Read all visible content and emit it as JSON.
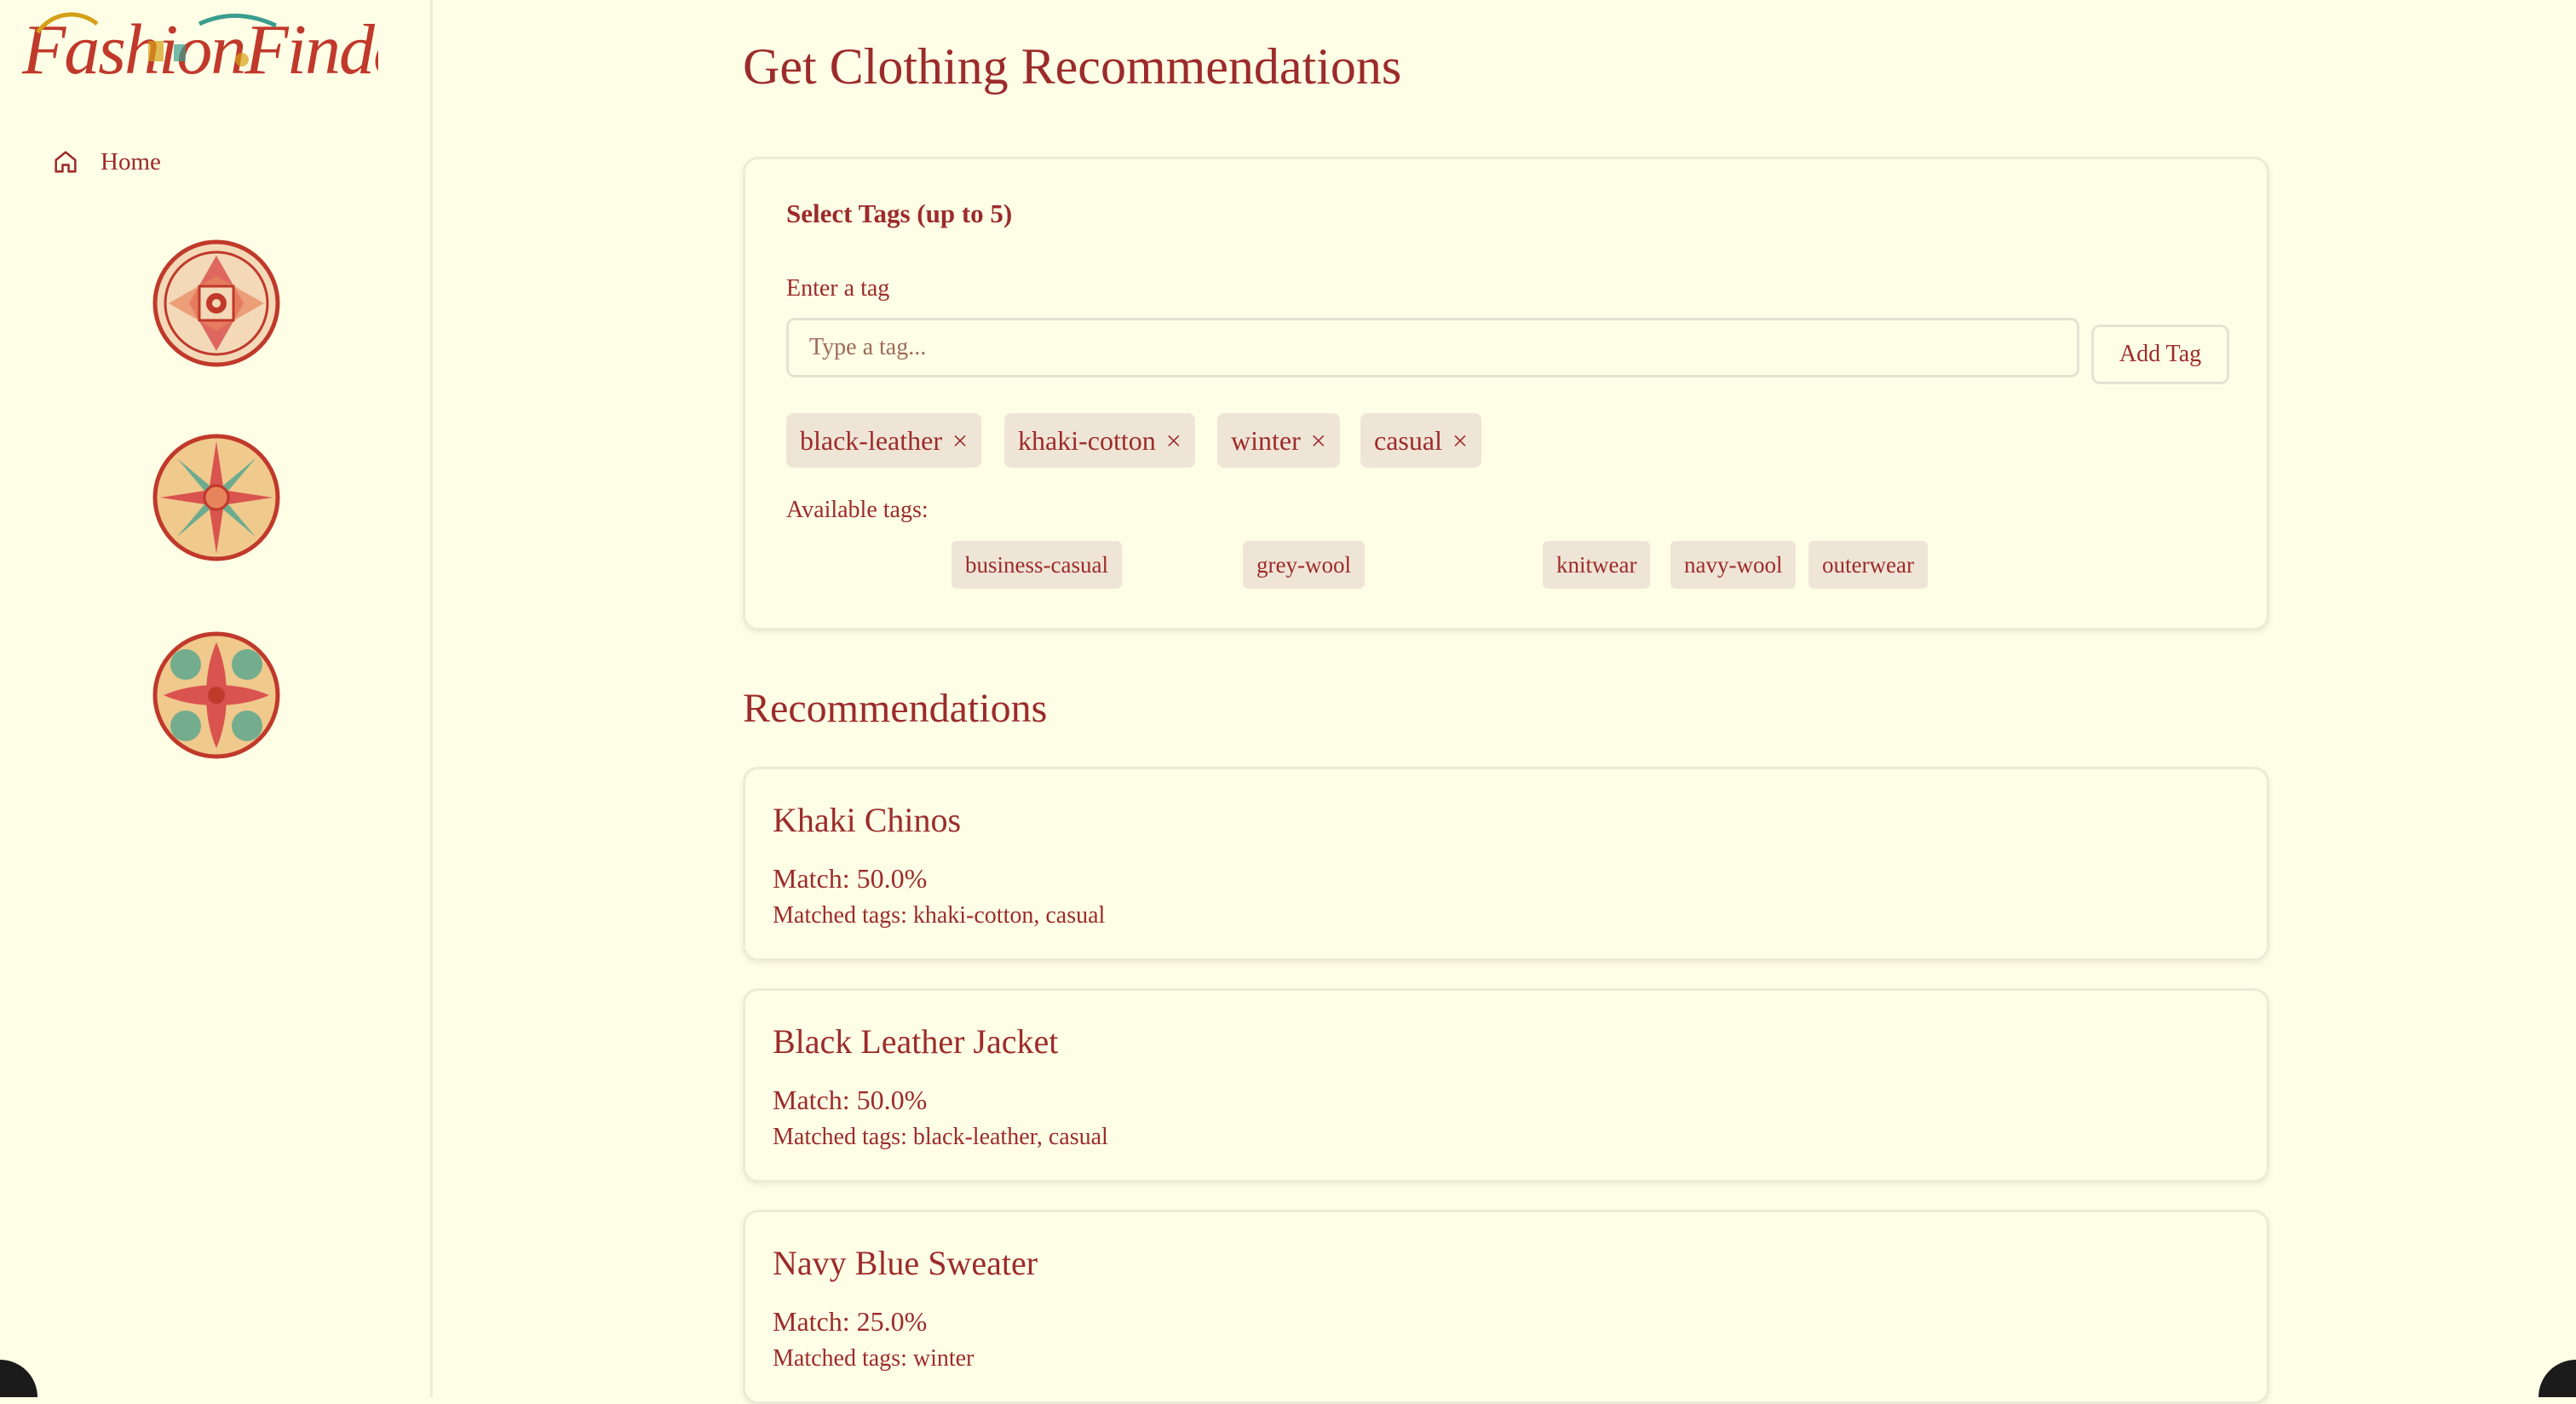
{
  "brand": {
    "logo_text": "FashionFinders"
  },
  "sidebar": {
    "home_label": "Home",
    "medallions": [
      "medallion-1",
      "medallion-2",
      "medallion-3"
    ]
  },
  "page": {
    "title": "Get Clothing Recommendations"
  },
  "tag_selector": {
    "heading": "Select Tags (up to 5)",
    "input_label": "Enter a tag",
    "input_value": "",
    "input_placeholder": "Type a tag...",
    "add_button_label": "Add Tag",
    "remove_icon": "×",
    "selected_tags": [
      "black-leather",
      "khaki-cotton",
      "winter",
      "casual"
    ],
    "available_label": "Available tags:",
    "available_tags": [
      "business-casual",
      "grey-wool",
      "knitwear",
      "navy-wool",
      "outerwear"
    ]
  },
  "recommendations": {
    "title": "Recommendations",
    "items": [
      {
        "name": "Khaki Chinos",
        "match": "Match: 50.0%",
        "matched_tags": "Matched tags: khaki-cotton, casual"
      },
      {
        "name": "Black Leather Jacket",
        "match": "Match: 50.0%",
        "matched_tags": "Matched tags: black-leather, casual"
      },
      {
        "name": "Navy Blue Sweater",
        "match": "Match: 25.0%",
        "matched_tags": "Matched tags: winter"
      }
    ]
  },
  "colors": {
    "background": "#fefee6",
    "text": "#9c2b2b",
    "chip_bg": "#efe5d6",
    "border": "#ecebd6"
  }
}
